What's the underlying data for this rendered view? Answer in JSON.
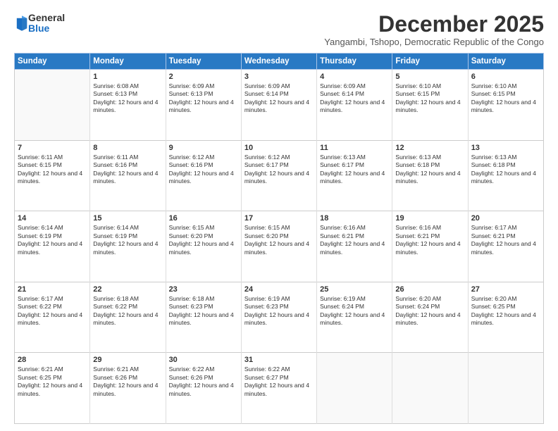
{
  "logo": {
    "general": "General",
    "blue": "Blue"
  },
  "header": {
    "title": "December 2025",
    "subtitle": "Yangambi, Tshopo, Democratic Republic of the Congo"
  },
  "days_of_week": [
    "Sunday",
    "Monday",
    "Tuesday",
    "Wednesday",
    "Thursday",
    "Friday",
    "Saturday"
  ],
  "weeks": [
    [
      {
        "day": "",
        "sunrise": "",
        "sunset": "",
        "daylight": "",
        "empty": true
      },
      {
        "day": "1",
        "sunrise": "Sunrise: 6:08 AM",
        "sunset": "Sunset: 6:13 PM",
        "daylight": "Daylight: 12 hours and 4 minutes."
      },
      {
        "day": "2",
        "sunrise": "Sunrise: 6:09 AM",
        "sunset": "Sunset: 6:13 PM",
        "daylight": "Daylight: 12 hours and 4 minutes."
      },
      {
        "day": "3",
        "sunrise": "Sunrise: 6:09 AM",
        "sunset": "Sunset: 6:14 PM",
        "daylight": "Daylight: 12 hours and 4 minutes."
      },
      {
        "day": "4",
        "sunrise": "Sunrise: 6:09 AM",
        "sunset": "Sunset: 6:14 PM",
        "daylight": "Daylight: 12 hours and 4 minutes."
      },
      {
        "day": "5",
        "sunrise": "Sunrise: 6:10 AM",
        "sunset": "Sunset: 6:15 PM",
        "daylight": "Daylight: 12 hours and 4 minutes."
      },
      {
        "day": "6",
        "sunrise": "Sunrise: 6:10 AM",
        "sunset": "Sunset: 6:15 PM",
        "daylight": "Daylight: 12 hours and 4 minutes."
      }
    ],
    [
      {
        "day": "7",
        "sunrise": "Sunrise: 6:11 AM",
        "sunset": "Sunset: 6:15 PM",
        "daylight": "Daylight: 12 hours and 4 minutes."
      },
      {
        "day": "8",
        "sunrise": "Sunrise: 6:11 AM",
        "sunset": "Sunset: 6:16 PM",
        "daylight": "Daylight: 12 hours and 4 minutes."
      },
      {
        "day": "9",
        "sunrise": "Sunrise: 6:12 AM",
        "sunset": "Sunset: 6:16 PM",
        "daylight": "Daylight: 12 hours and 4 minutes."
      },
      {
        "day": "10",
        "sunrise": "Sunrise: 6:12 AM",
        "sunset": "Sunset: 6:17 PM",
        "daylight": "Daylight: 12 hours and 4 minutes."
      },
      {
        "day": "11",
        "sunrise": "Sunrise: 6:13 AM",
        "sunset": "Sunset: 6:17 PM",
        "daylight": "Daylight: 12 hours and 4 minutes."
      },
      {
        "day": "12",
        "sunrise": "Sunrise: 6:13 AM",
        "sunset": "Sunset: 6:18 PM",
        "daylight": "Daylight: 12 hours and 4 minutes."
      },
      {
        "day": "13",
        "sunrise": "Sunrise: 6:13 AM",
        "sunset": "Sunset: 6:18 PM",
        "daylight": "Daylight: 12 hours and 4 minutes."
      }
    ],
    [
      {
        "day": "14",
        "sunrise": "Sunrise: 6:14 AM",
        "sunset": "Sunset: 6:19 PM",
        "daylight": "Daylight: 12 hours and 4 minutes."
      },
      {
        "day": "15",
        "sunrise": "Sunrise: 6:14 AM",
        "sunset": "Sunset: 6:19 PM",
        "daylight": "Daylight: 12 hours and 4 minutes."
      },
      {
        "day": "16",
        "sunrise": "Sunrise: 6:15 AM",
        "sunset": "Sunset: 6:20 PM",
        "daylight": "Daylight: 12 hours and 4 minutes."
      },
      {
        "day": "17",
        "sunrise": "Sunrise: 6:15 AM",
        "sunset": "Sunset: 6:20 PM",
        "daylight": "Daylight: 12 hours and 4 minutes."
      },
      {
        "day": "18",
        "sunrise": "Sunrise: 6:16 AM",
        "sunset": "Sunset: 6:21 PM",
        "daylight": "Daylight: 12 hours and 4 minutes."
      },
      {
        "day": "19",
        "sunrise": "Sunrise: 6:16 AM",
        "sunset": "Sunset: 6:21 PM",
        "daylight": "Daylight: 12 hours and 4 minutes."
      },
      {
        "day": "20",
        "sunrise": "Sunrise: 6:17 AM",
        "sunset": "Sunset: 6:21 PM",
        "daylight": "Daylight: 12 hours and 4 minutes."
      }
    ],
    [
      {
        "day": "21",
        "sunrise": "Sunrise: 6:17 AM",
        "sunset": "Sunset: 6:22 PM",
        "daylight": "Daylight: 12 hours and 4 minutes."
      },
      {
        "day": "22",
        "sunrise": "Sunrise: 6:18 AM",
        "sunset": "Sunset: 6:22 PM",
        "daylight": "Daylight: 12 hours and 4 minutes."
      },
      {
        "day": "23",
        "sunrise": "Sunrise: 6:18 AM",
        "sunset": "Sunset: 6:23 PM",
        "daylight": "Daylight: 12 hours and 4 minutes."
      },
      {
        "day": "24",
        "sunrise": "Sunrise: 6:19 AM",
        "sunset": "Sunset: 6:23 PM",
        "daylight": "Daylight: 12 hours and 4 minutes."
      },
      {
        "day": "25",
        "sunrise": "Sunrise: 6:19 AM",
        "sunset": "Sunset: 6:24 PM",
        "daylight": "Daylight: 12 hours and 4 minutes."
      },
      {
        "day": "26",
        "sunrise": "Sunrise: 6:20 AM",
        "sunset": "Sunset: 6:24 PM",
        "daylight": "Daylight: 12 hours and 4 minutes."
      },
      {
        "day": "27",
        "sunrise": "Sunrise: 6:20 AM",
        "sunset": "Sunset: 6:25 PM",
        "daylight": "Daylight: 12 hours and 4 minutes."
      }
    ],
    [
      {
        "day": "28",
        "sunrise": "Sunrise: 6:21 AM",
        "sunset": "Sunset: 6:25 PM",
        "daylight": "Daylight: 12 hours and 4 minutes."
      },
      {
        "day": "29",
        "sunrise": "Sunrise: 6:21 AM",
        "sunset": "Sunset: 6:26 PM",
        "daylight": "Daylight: 12 hours and 4 minutes."
      },
      {
        "day": "30",
        "sunrise": "Sunrise: 6:22 AM",
        "sunset": "Sunset: 6:26 PM",
        "daylight": "Daylight: 12 hours and 4 minutes."
      },
      {
        "day": "31",
        "sunrise": "Sunrise: 6:22 AM",
        "sunset": "Sunset: 6:27 PM",
        "daylight": "Daylight: 12 hours and 4 minutes."
      },
      {
        "day": "",
        "sunrise": "",
        "sunset": "",
        "daylight": "",
        "empty": true
      },
      {
        "day": "",
        "sunrise": "",
        "sunset": "",
        "daylight": "",
        "empty": true
      },
      {
        "day": "",
        "sunrise": "",
        "sunset": "",
        "daylight": "",
        "empty": true
      }
    ]
  ]
}
